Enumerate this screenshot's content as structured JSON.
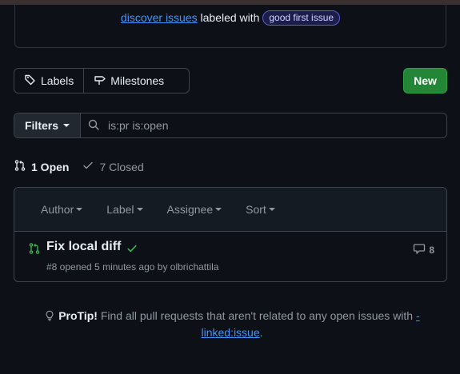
{
  "notice": {
    "link_text": "discover issues",
    "mid_text": "labeled with",
    "badge_text": "good first issue"
  },
  "toolbar": {
    "labels_label": "Labels",
    "milestones_label": "Milestones",
    "new_label": "New"
  },
  "filter": {
    "filters_label": "Filters",
    "query": "is:pr is:open"
  },
  "states": {
    "open_label": "1 Open",
    "closed_label": "7 Closed"
  },
  "list_header": {
    "sorters": [
      "Author",
      "Label",
      "Assignee",
      "Sort"
    ]
  },
  "pulls": [
    {
      "title": "Fix local diff",
      "meta": "#8 opened 5 minutes ago by olbrichattila",
      "comments": "8",
      "status_icon": "check-icon"
    }
  ],
  "protip": {
    "label": "ProTip!",
    "text": "Find all pull requests that aren't related to any open issues with",
    "link_text": "-linked:issue",
    "end": "."
  },
  "colors": {
    "accent": "#4493f8",
    "new_button": "#238636",
    "open_pr": "#3fb950"
  }
}
